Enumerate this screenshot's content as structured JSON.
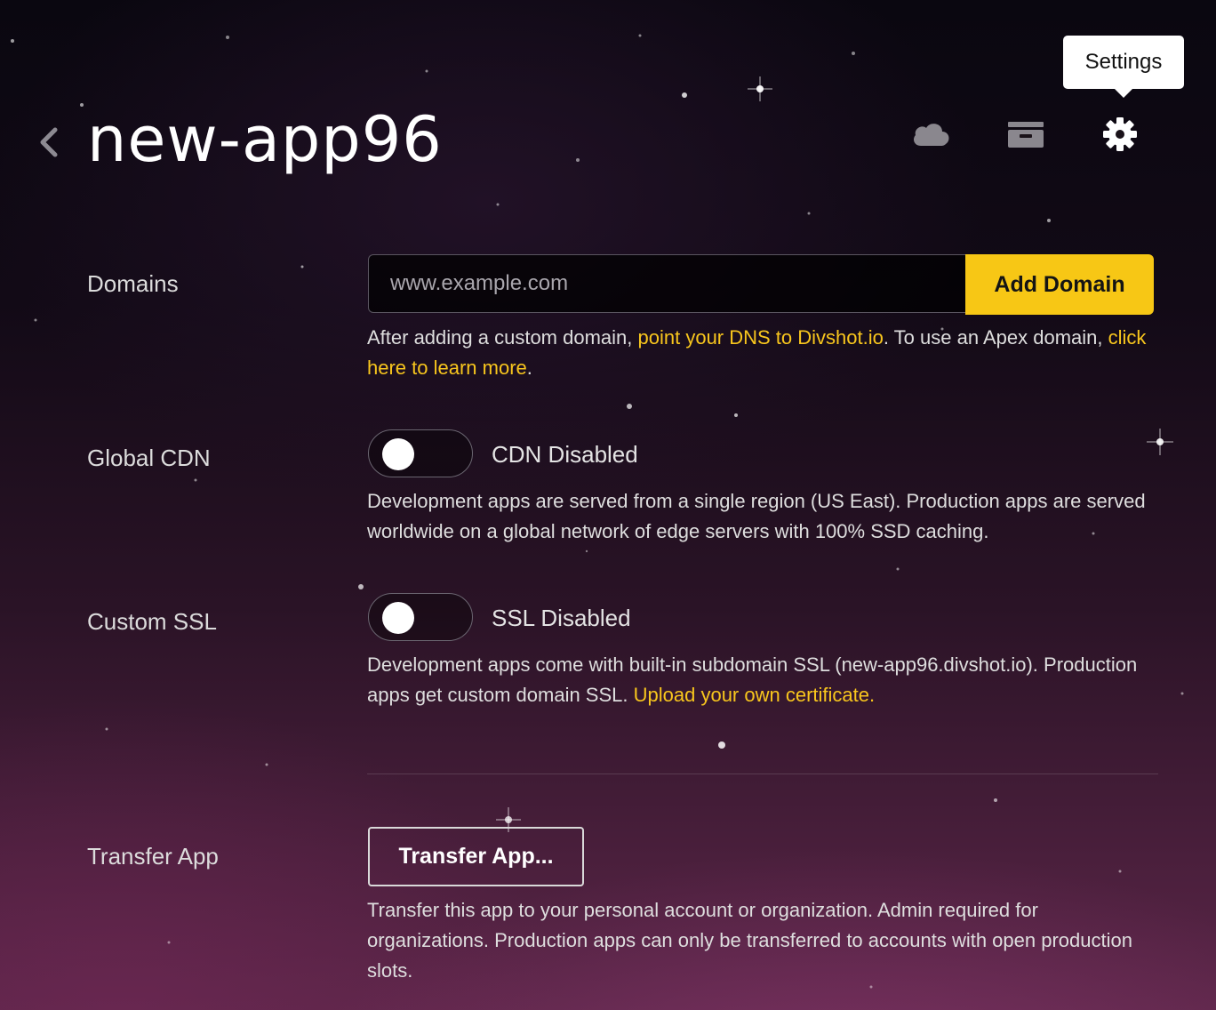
{
  "header": {
    "title": "new-app96",
    "tooltip": "Settings",
    "icons": [
      "chevron-left-icon",
      "cloud-icon",
      "wallet-icon",
      "gear-icon"
    ]
  },
  "domains": {
    "label": "Domains",
    "placeholder": "www.example.com",
    "button": "Add Domain",
    "desc_before": "After adding a custom domain,",
    "link_dns": "point your DNS to Divshot.io",
    "desc_middle": ". To use an Apex domain,",
    "link_learn": "click here to learn more",
    "desc_end": "."
  },
  "cdn": {
    "label": "Global CDN",
    "state": "CDN Disabled",
    "enabled": false,
    "desc": "Development apps are served from a single region (US East). Production apps are served worldwide on a global network of edge servers with 100% SSD caching."
  },
  "ssl": {
    "label": "Custom SSL",
    "state": "SSL Disabled",
    "enabled": false,
    "desc": "Development apps come with built-in subdomain SSL (new-app96.divshot.io). Production apps get custom domain SSL.",
    "link": "Upload your own certificate."
  },
  "transfer": {
    "label": "Transfer App",
    "button": "Transfer App...",
    "desc": "Transfer this app to your personal account or organization. Admin required for organizations. Production apps can only be transferred to accounts with open production slots."
  },
  "colors": {
    "accent": "#f7c715",
    "link": "#f8c61d",
    "text": "#dedede"
  }
}
